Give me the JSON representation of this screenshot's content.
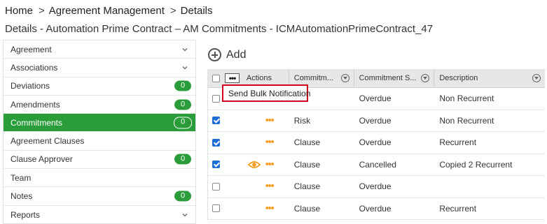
{
  "breadcrumb": [
    "Home",
    "Agreement Management",
    "Details"
  ],
  "page_title": "Details - Automation Prime Contract – AM Commitments - ICMAutomationPrimeContract_47",
  "sidebar": {
    "items": [
      {
        "label": "Agreement",
        "chevron": true,
        "badge": null,
        "active": false
      },
      {
        "label": "Associations",
        "chevron": true,
        "badge": null,
        "active": false
      },
      {
        "label": "Deviations",
        "chevron": false,
        "badge": "0",
        "active": false
      },
      {
        "label": "Amendments",
        "chevron": false,
        "badge": "0",
        "active": false
      },
      {
        "label": "Commitments",
        "chevron": false,
        "badge": "0",
        "active": true
      },
      {
        "label": "Agreement Clauses",
        "chevron": false,
        "badge": null,
        "active": false
      },
      {
        "label": "Clause Approver",
        "chevron": false,
        "badge": "0",
        "active": false
      },
      {
        "label": "Team",
        "chevron": false,
        "badge": null,
        "active": false
      },
      {
        "label": "Notes",
        "chevron": false,
        "badge": "0",
        "active": false
      },
      {
        "label": "Reports",
        "chevron": true,
        "badge": null,
        "active": false
      }
    ]
  },
  "toolbar": {
    "add_label": "Add",
    "add_icon": "plus-circle-icon"
  },
  "grid": {
    "more_icon_label": "•••",
    "columns": [
      "Actions",
      "Commitm...",
      "Commitment S...",
      "Description"
    ],
    "rows": [
      {
        "checked": false,
        "eye": false,
        "type": "",
        "status": "Overdue",
        "description": "Non Recurrent"
      },
      {
        "checked": true,
        "eye": false,
        "type": "Risk",
        "status": "Overdue",
        "description": "Non Recurrent"
      },
      {
        "checked": true,
        "eye": false,
        "type": "Clause",
        "status": "Overdue",
        "description": "Recurrent"
      },
      {
        "checked": true,
        "eye": true,
        "type": "Clause",
        "status": "Cancelled",
        "description": "Copied 2 Recurrent"
      },
      {
        "checked": false,
        "eye": false,
        "type": "Clause",
        "status": "Overdue",
        "description": ""
      },
      {
        "checked": false,
        "eye": false,
        "type": "Clause",
        "status": "Overdue",
        "description": "Recurrent"
      }
    ]
  },
  "popup": {
    "label": "Send Bulk Notification"
  },
  "colors": {
    "accent": "#2a9d3a",
    "action_dots": "#f39c1f",
    "highlight_border": "#d0021b",
    "checkbox": "#1a6fd6"
  }
}
